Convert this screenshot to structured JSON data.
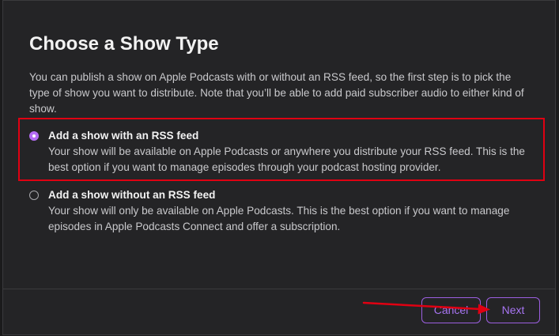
{
  "dialog": {
    "title": "Choose a Show Type",
    "description": "You can publish a show on Apple Podcasts with or without an RSS feed, so the first step is to pick the type of show you want to distribute. Note that you’ll be able to add paid subscriber audio to either kind of show."
  },
  "options": [
    {
      "title": "Add a show with an RSS feed",
      "description": "Your show will be available on Apple Podcasts or anywhere you distribute your RSS feed. This is the best option if you want to manage episodes through your podcast hosting provider.",
      "selected": true
    },
    {
      "title": "Add a show without an RSS feed",
      "description": "Your show will only be available on Apple Podcasts. This is the best option if you want to manage episodes in Apple Podcasts Connect and offer a subscription.",
      "selected": false
    }
  ],
  "footer": {
    "cancel_label": "Cancel",
    "next_label": "Next"
  },
  "colors": {
    "accent": "#a775f2",
    "annotation": "#e00012",
    "background": "#242426"
  }
}
